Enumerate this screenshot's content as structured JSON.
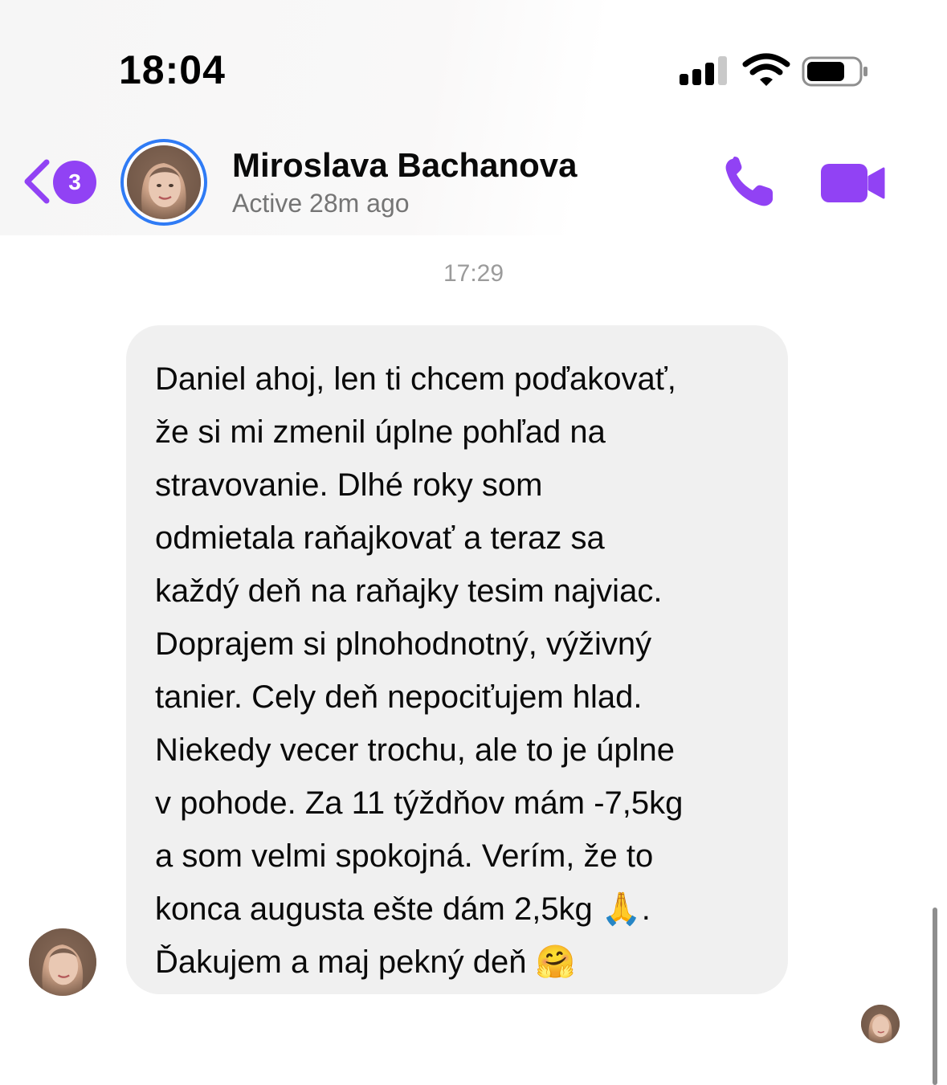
{
  "status_bar": {
    "time": "18:04"
  },
  "header": {
    "back_badge_count": "3",
    "contact_name": "Miroslava Bachanova",
    "contact_status": "Active 28m ago",
    "accent_color": "#9142f4",
    "ring_color": "#2f7bf5",
    "icons": [
      "back-chevron-icon",
      "phone-icon",
      "video-camera-icon"
    ]
  },
  "conversation": {
    "timestamp": "17:29",
    "message_lines": [
      "Daniel ahoj, len ti chcem poďakovať,",
      "že si mi zmenil úplne pohľad na",
      "stravovanie. Dlhé roky som",
      "odmietala raňajkovať a teraz sa",
      "každý deň na raňajky tesim najviac.",
      "Doprajem si plnohodnotný, výživný",
      "tanier. Cely deň nepociťujem hlad.",
      "Niekedy vecer trochu, ale to je úplne",
      "v pohode. Za 11 týždňov mám -7,5kg",
      "a som velmi spokojná. Verím, že to",
      "konca augusta ešte dám 2,5kg 🙏.",
      "Ďakujem a maj pekný deň 🤗"
    ]
  }
}
